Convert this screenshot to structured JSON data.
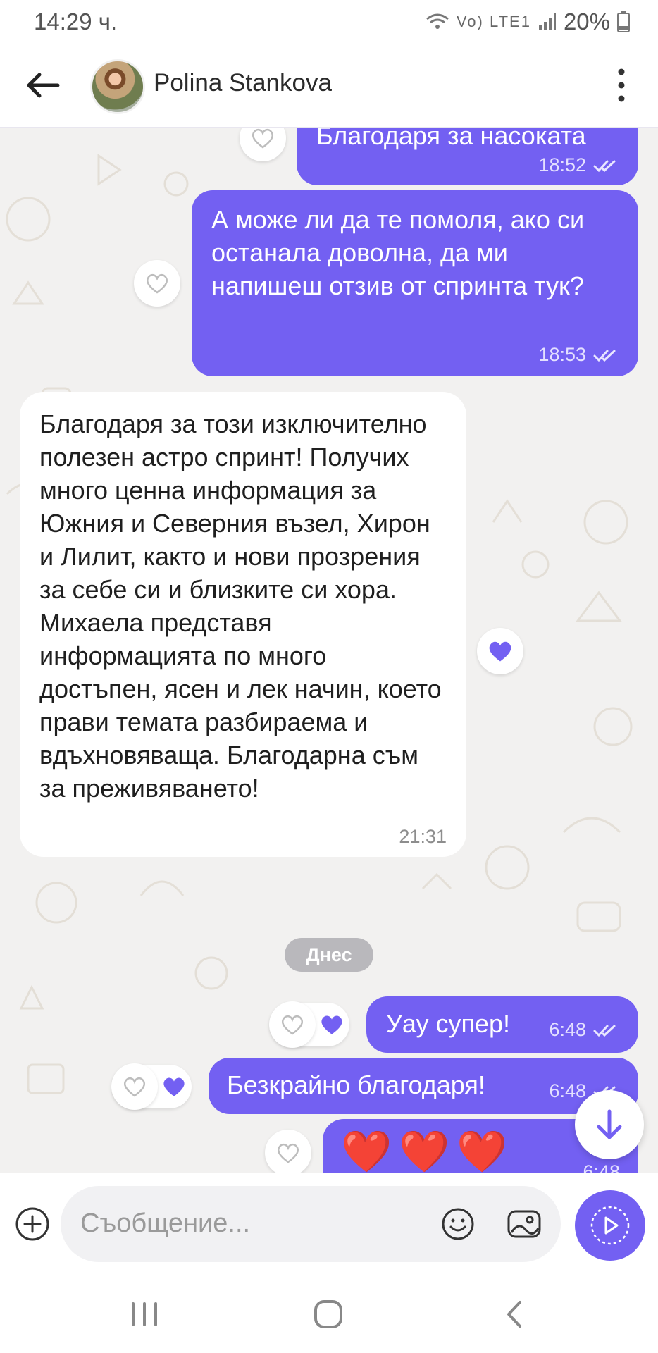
{
  "status_bar": {
    "time": "14:29 ч.",
    "network": "Vo) LTE1",
    "battery": "20%"
  },
  "header": {
    "contact_name": "Polina Stankova"
  },
  "messages": [
    {
      "text": "Благодаря за насоката",
      "time": "18:52",
      "direction": "outgoing"
    },
    {
      "text": "А може ли да те помоля, ако си останала доволна, да ми напишеш отзив от спринта тук?",
      "time": "18:53",
      "direction": "outgoing"
    },
    {
      "text": "Благодаря за този изключително полезен астро спринт! Получих много ценна информация за Южния и Северния възел, Хирон и Лилит, както и нови прозрения за себе си и близките си хора. Михаела представя информацията по много достъпен, ясен и лек начин, което прави темата разбираема и вдъхновяваща. Благодарна съм за преживяването!",
      "time": "21:31",
      "direction": "incoming"
    },
    {
      "text": "Уау супер!",
      "time": "6:48",
      "direction": "outgoing"
    },
    {
      "text": "Безкрайно благодаря!",
      "time": "6:48",
      "direction": "outgoing"
    },
    {
      "text": "❤️❤️❤️",
      "time": "6:48",
      "direction": "outgoing"
    }
  ],
  "date_separator": "Днес",
  "composer": {
    "placeholder": "Съобщение..."
  },
  "colors": {
    "accent": "#7360f2",
    "chat_background": "#f2f1f0",
    "incoming_bubble": "#ffffff"
  },
  "icons": [
    "back-arrow-icon",
    "more-vertical-icon",
    "heart-outline-icon",
    "heart-filled-icon",
    "double-check-icon",
    "arrow-down-icon",
    "plus-circle-icon",
    "emoji-icon",
    "gallery-icon",
    "send-icon"
  ]
}
